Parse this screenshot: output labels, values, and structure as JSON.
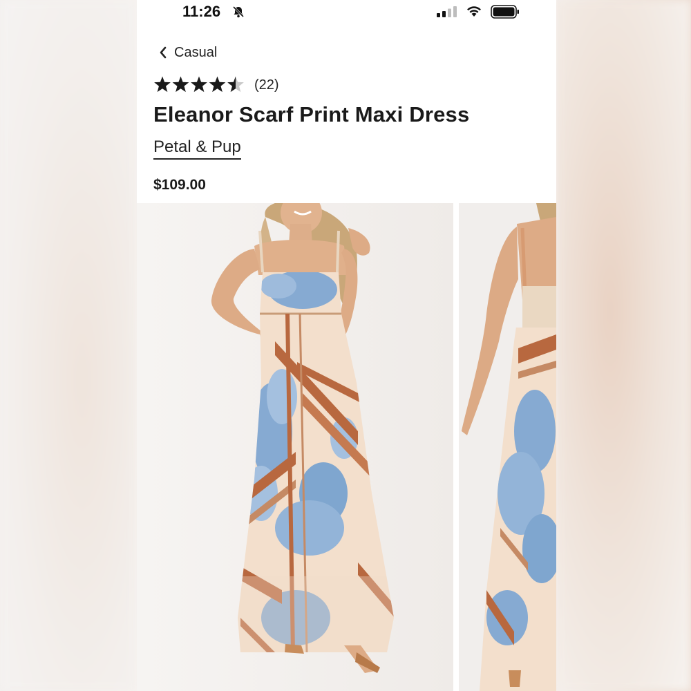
{
  "status_bar": {
    "time": "11:26",
    "icons": [
      "bell-slash-icon",
      "cellular-signal-icon",
      "wifi-icon",
      "battery-icon"
    ]
  },
  "nav": {
    "back_label": "Casual",
    "back_icon": "chevron-left-icon"
  },
  "product": {
    "rating": 4.5,
    "rating_max": 5,
    "review_count": "(22)",
    "title": "Eleanor Scarf Print Maxi Dress",
    "brand": "Petal & Pup",
    "price": "$109.00"
  },
  "gallery": {
    "images": [
      "dress-front-photo",
      "dress-back-photo"
    ]
  },
  "colors": {
    "star_filled": "#1a1a1a",
    "star_empty": "#c8c8c8",
    "dress_base": "#f3dfcc",
    "dress_blue": "#7fa6cf",
    "dress_rust": "#b8683f"
  }
}
